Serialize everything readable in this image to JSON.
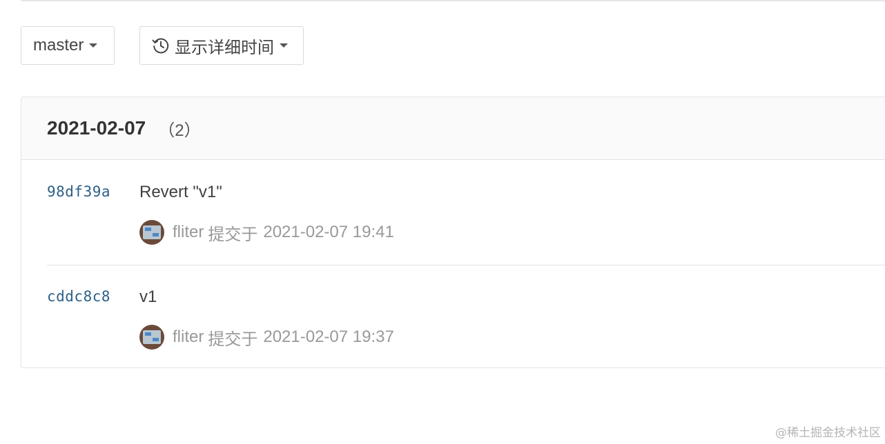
{
  "toolbar": {
    "branch": "master",
    "time_mode": "显示详细时间",
    "time_icon": "history-icon"
  },
  "group": {
    "date": "2021-02-07",
    "count": "（2）"
  },
  "commits": [
    {
      "sha": "98df39a",
      "message": "Revert \"v1\"",
      "author": "fliter",
      "action": "提交于",
      "timestamp": "2021-02-07 19:41"
    },
    {
      "sha": "cddc8c8",
      "message": "v1",
      "author": "fliter",
      "action": "提交于",
      "timestamp": "2021-02-07 19:37"
    }
  ],
  "watermark": "@稀土掘金技术社区"
}
